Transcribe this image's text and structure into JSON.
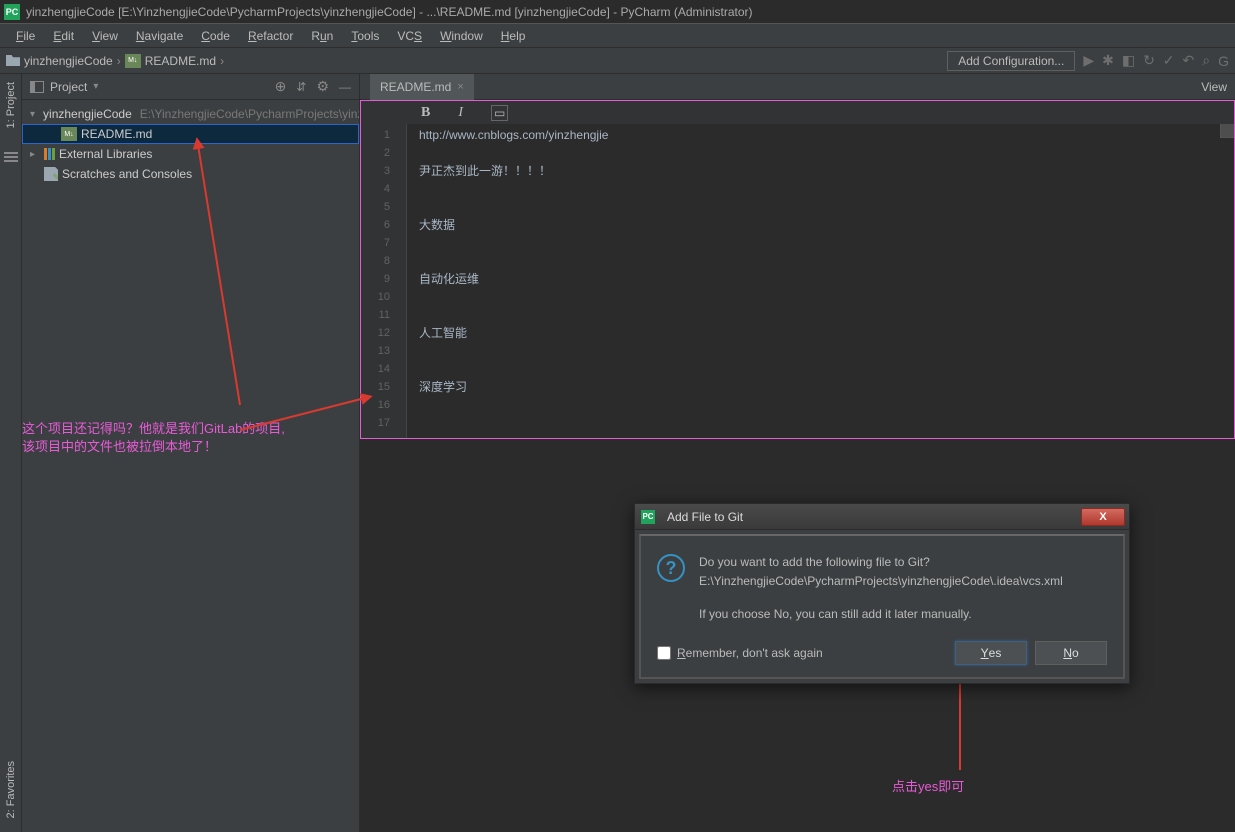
{
  "titlebar": {
    "icon_text": "PC",
    "text": "yinzhengjieCode [E:\\YinzhengjieCode\\PycharmProjects\\yinzhengjieCode] - ...\\README.md [yinzhengjieCode] - PyCharm (Administrator)"
  },
  "menu": {
    "file": "File",
    "edit": "Edit",
    "view": "View",
    "navigate": "Navigate",
    "code": "Code",
    "refactor": "Refactor",
    "run": "Run",
    "tools": "Tools",
    "vcs": "VCS",
    "window": "Window",
    "help": "Help"
  },
  "breadcrumb": {
    "project": "yinzhengjieCode",
    "file": "README.md"
  },
  "nav_right": {
    "add_configuration": "Add Configuration..."
  },
  "sidebar_tabs": {
    "project": "1: Project",
    "favorites": "2: Favorites"
  },
  "project_panel": {
    "title": "Project",
    "tree": {
      "root": "yinzhengjieCode",
      "root_path": "E:\\YinzhengjieCode\\PycharmProjects\\yinzhengjieCode",
      "readme": "README.md",
      "ext_libs": "External Libraries",
      "scratches": "Scratches and Consoles"
    }
  },
  "editor": {
    "tab_name": "README.md",
    "view_label": "View",
    "lines": [
      1,
      2,
      3,
      4,
      5,
      6,
      7,
      8,
      9,
      10,
      11,
      12,
      13,
      14,
      15,
      16,
      17
    ],
    "content": {
      "l1": "http://www.cnblogs.com/yinzhengjie",
      "l3": "尹正杰到此一游！！！！",
      "l6": "大数据",
      "l9": "自动化运维",
      "l12": "人工智能",
      "l15": "深度学习"
    }
  },
  "dialog": {
    "title": "Add File to Git",
    "line1": "Do you want to add the following file to Git?",
    "line2": "E:\\YinzhengjieCode\\PycharmProjects\\yinzhengjieCode\\.idea\\vcs.xml",
    "line3": "If you choose No, you can still add it later manually.",
    "remember": "Remember, don't ask again",
    "yes": "Yes",
    "no": "No"
  },
  "annotations": {
    "a1_line1": "这个项目还记得吗？他就是我们GitLab的项目,",
    "a1_line2": "该项目中的文件也被拉倒本地了！",
    "a2": "点击yes即可"
  }
}
